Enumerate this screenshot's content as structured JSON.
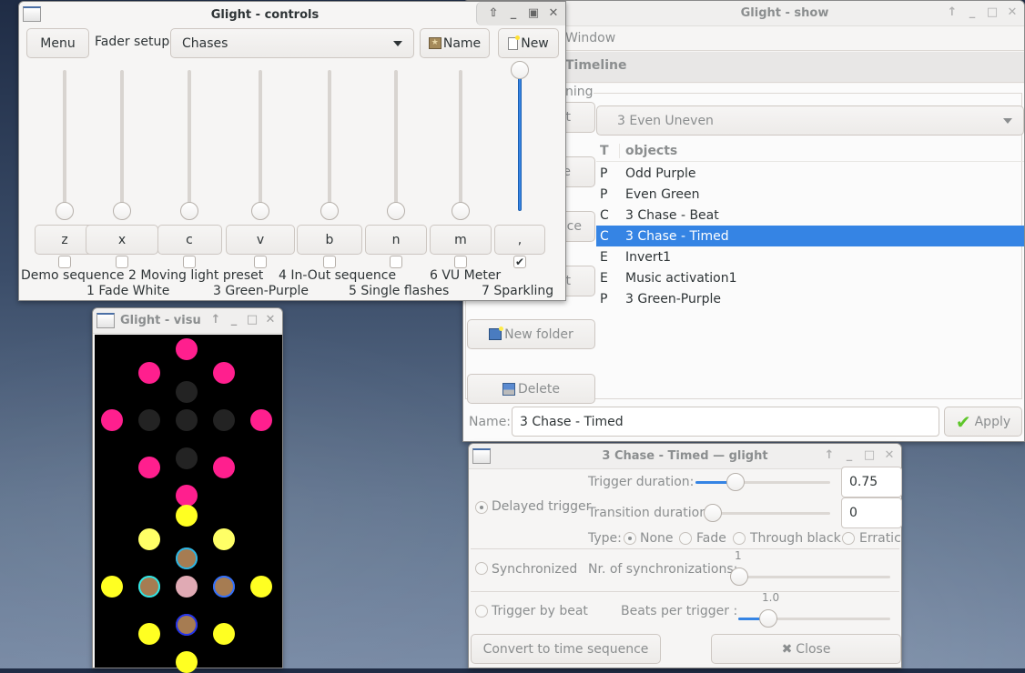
{
  "controls": {
    "title": "Glight - controls",
    "menu_label": "Menu",
    "fader_setup_label": "Fader setup:",
    "fader_setup_value": "Chases",
    "name_button": "Name",
    "new_button": "New",
    "faders": [
      {
        "key": "z",
        "level": 0,
        "checked": false
      },
      {
        "key": "x",
        "level": 0,
        "checked": false
      },
      {
        "key": "c",
        "level": 0,
        "checked": false
      },
      {
        "key": "v",
        "level": 0,
        "checked": false
      },
      {
        "key": "b",
        "level": 0,
        "checked": false
      },
      {
        "key": "n",
        "level": 0,
        "checked": false
      },
      {
        "key": "m",
        "level": 0,
        "checked": false
      },
      {
        "key": ",",
        "level": 1,
        "checked": true
      }
    ],
    "fader_labels_top": [
      "Demo sequence",
      "2 Moving light preset",
      "4 In-Out sequence",
      "6 VU Meter"
    ],
    "fader_labels_bottom": [
      "1 Fade White",
      "3 Green-Purple",
      "5 Single flashes",
      "7 Sparkling"
    ]
  },
  "show": {
    "title": "Glight - show",
    "menu_partial": "Window",
    "tab_partial": "Timeline",
    "frame_partial": "ning",
    "folder_combo": "3 Even Uneven",
    "hidden_buttons_partial": [
      "t",
      "e",
      "nce",
      "t"
    ],
    "columns": {
      "type": "T",
      "name": "objects"
    },
    "objects": [
      {
        "type": "P",
        "name": "Odd Purple"
      },
      {
        "type": "P",
        "name": "Even Green"
      },
      {
        "type": "C",
        "name": "3 Chase - Beat"
      },
      {
        "type": "C",
        "name": "3 Chase - Timed",
        "selected": true
      },
      {
        "type": "E",
        "name": "Invert1"
      },
      {
        "type": "E",
        "name": "Music activation1"
      },
      {
        "type": "P",
        "name": "3 Green-Purple"
      }
    ],
    "new_folder_button": "New folder",
    "delete_button": "Delete",
    "name_label": "Name:",
    "name_value": "3 Chase - Timed",
    "apply_button": "Apply",
    "selection_color": "#3584e4"
  },
  "visu": {
    "title": "Glight - visu",
    "lamps_top": [
      {
        "c": "#ff1f8e"
      },
      {
        "c": "#ff1f8e"
      },
      {
        "c": "#232323"
      },
      {
        "c": "#ff1f8e"
      },
      {
        "c": "#ff1f8e"
      },
      {
        "c": "#232323"
      },
      {
        "c": "#232323"
      },
      {
        "c": "#232323"
      },
      {
        "c": "#ff1f8e"
      },
      {
        "c": "#ff1f8e"
      },
      {
        "c": "#232323"
      },
      {
        "c": "#ff1f8e"
      },
      {
        "c": "#ff1f8e"
      }
    ],
    "lamps_bottom": [
      {
        "c": "#ffff22"
      },
      {
        "c": "#ffff66"
      },
      {
        "c": "#a67c52",
        "ring": "#29b6e6"
      },
      {
        "c": "#ffff66"
      },
      {
        "c": "#ffff22"
      },
      {
        "c": "#a67c52",
        "ring": "#2ee6e6"
      },
      {
        "c": "#e0aab4"
      },
      {
        "c": "#a67c52",
        "ring": "#2f6fff"
      },
      {
        "c": "#ffff22"
      },
      {
        "c": "#ffff22"
      },
      {
        "c": "#a67c52",
        "ring": "#2233ee"
      },
      {
        "c": "#ffff22"
      },
      {
        "c": "#ffff22"
      }
    ]
  },
  "chase": {
    "title": "3 Chase - Timed — glight",
    "delayed_trigger_label": "Delayed trigger",
    "delayed_trigger_selected": true,
    "trigger_duration_label": "Trigger duration:",
    "trigger_duration_value": "0.75",
    "trigger_duration_fraction": 0.3,
    "transition_duration_label": "Transition duration:",
    "transition_duration_value": "0",
    "type_label": "Type:",
    "type_options": [
      "None",
      "Fade",
      "Through black",
      "Erratic"
    ],
    "type_selected": "None",
    "synchronized_label": "Synchronized",
    "nr_sync_label": "Nr. of synchronizations:",
    "nr_sync_value": "1",
    "trigger_by_beat_label": "Trigger by beat",
    "beats_per_trigger_label": "Beats per trigger :",
    "beats_per_trigger_value": "1.0",
    "beats_fraction": 0.2,
    "convert_button": "Convert to time sequence",
    "close_button": "Close"
  }
}
